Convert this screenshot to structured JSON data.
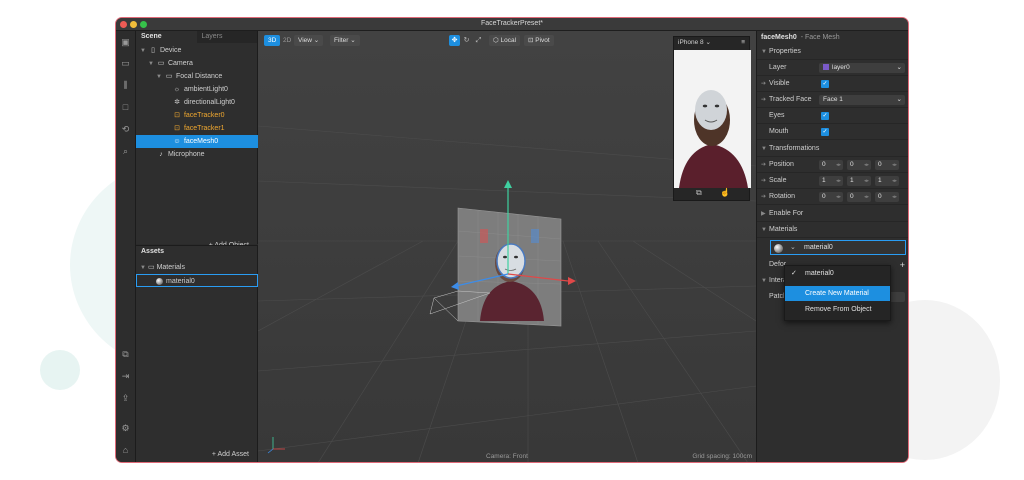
{
  "window": {
    "title": "FaceTrackerPreset*"
  },
  "colors": {
    "accent": "#1d8fe0",
    "selected_orange": "#f0a830",
    "window_border": "#e06a78"
  },
  "scene_panel": {
    "tabs": [
      "Scene",
      "Layers"
    ],
    "tree": [
      {
        "label": "Device",
        "icon": "device-icon"
      },
      {
        "label": "Camera",
        "icon": "camera-icon"
      },
      {
        "label": "Focal Distance",
        "icon": "focal-icon"
      },
      {
        "label": "ambientLight0",
        "icon": "ambient-light-icon"
      },
      {
        "label": "directionalLight0",
        "icon": "directional-light-icon"
      },
      {
        "label": "faceTracker0",
        "icon": "face-tracker-icon"
      },
      {
        "label": "faceTracker1",
        "icon": "face-tracker-icon"
      },
      {
        "label": "faceMesh0",
        "icon": "face-mesh-icon"
      },
      {
        "label": "Microphone",
        "icon": "microphone-icon"
      }
    ],
    "add_object": "+ Add Object"
  },
  "assets_panel": {
    "title": "Assets",
    "items": [
      {
        "label": "Materials",
        "icon": "folder-icon"
      },
      {
        "label": "material0",
        "icon": "material-sphere-icon"
      }
    ],
    "add_asset": "+ Add Asset"
  },
  "viewport": {
    "mode_3d": "3D",
    "mode_2d": "2D",
    "view_label": "View",
    "filter_label": "Filter",
    "local_label": "Local",
    "pivot_label": "Pivot",
    "camera_label": "Camera: Front",
    "grid_label": "Grid spacing: 100cm",
    "device_label": "iPhone 8"
  },
  "inspector": {
    "object_name": "faceMesh0",
    "object_type": "- Face Mesh",
    "properties_title": "Properties",
    "layer_label": "Layer",
    "layer_value": "layer0",
    "visible_label": "Visible",
    "tracked_face_label": "Tracked Face",
    "tracked_face_value": "Face 1",
    "eyes_label": "Eyes",
    "mouth_label": "Mouth",
    "transformations_title": "Transformations",
    "position_label": "Position",
    "position": [
      "0",
      "0",
      "0"
    ],
    "scale_label": "Scale",
    "scale": [
      "1",
      "1",
      "1"
    ],
    "rotation_label": "Rotation",
    "rotation": [
      "0",
      "0",
      "0"
    ],
    "enable_for_label": "Enable For",
    "materials_title": "Materials",
    "material_value": "material0",
    "deform_label": "Defor",
    "interact_label": "Intera",
    "patch_label": "Patch"
  },
  "dropdown_menu": {
    "items": [
      "material0",
      "Create New Material",
      "Remove From Object"
    ]
  }
}
